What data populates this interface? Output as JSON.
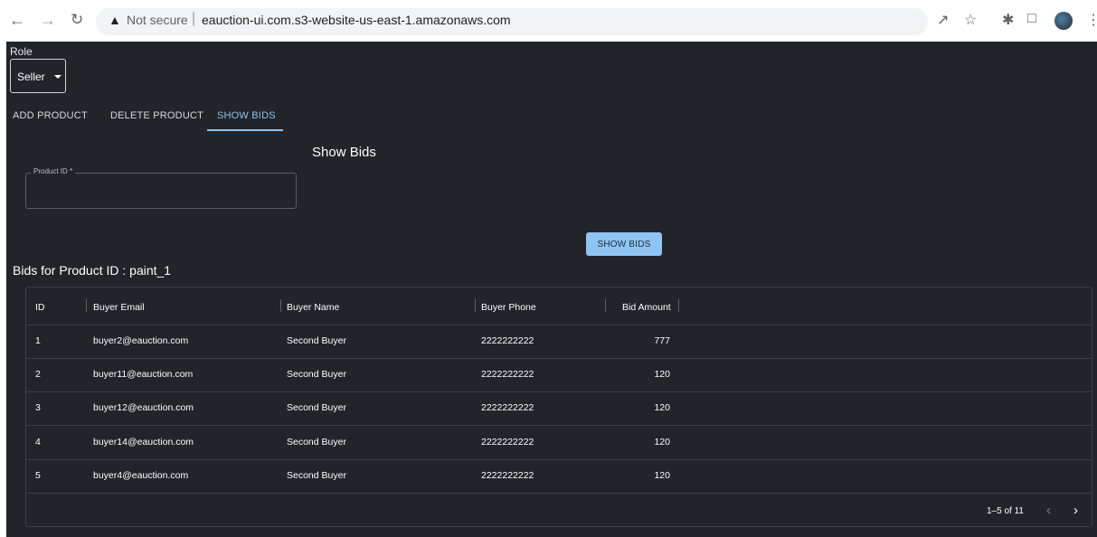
{
  "browser": {
    "back_icon": "arrow-left-icon",
    "forward_icon": "arrow-right-icon",
    "reload_icon": "reload-icon",
    "security_label": "Not secure",
    "url": "eauction-ui.com.s3-website-us-east-1.amazonaws.com",
    "icons": [
      "share-icon",
      "star-icon",
      "extensions-icon",
      "sidepanel-icon",
      "profile-avatar",
      "menu-icon"
    ]
  },
  "role": {
    "label": "Role",
    "value": "Seller"
  },
  "tabs": [
    {
      "label": "ADD PRODUCT",
      "active": false
    },
    {
      "label": "DELETE PRODUCT",
      "active": false
    },
    {
      "label": "SHOW BIDS",
      "active": true
    }
  ],
  "form": {
    "title": "Show Bids",
    "product_id_label": "Product ID *",
    "product_id_value": "",
    "submit_label": "SHOW BIDS"
  },
  "bids": {
    "heading": "Bids for Product ID : paint_1",
    "columns": [
      "ID",
      "Buyer Email",
      "Buyer Name",
      "Buyer Phone",
      "Bid Amount"
    ],
    "rows": [
      {
        "id": "1",
        "email": "buyer2@eauction.com",
        "name": "Second Buyer",
        "phone": "2222222222",
        "amount": "777"
      },
      {
        "id": "2",
        "email": "buyer11@eauction.com",
        "name": "Second Buyer",
        "phone": "2222222222",
        "amount": "120"
      },
      {
        "id": "3",
        "email": "buyer12@eauction.com",
        "name": "Second Buyer",
        "phone": "2222222222",
        "amount": "120"
      },
      {
        "id": "4",
        "email": "buyer14@eauction.com",
        "name": "Second Buyer",
        "phone": "2222222222",
        "amount": "120"
      },
      {
        "id": "5",
        "email": "buyer4@eauction.com",
        "name": "Second Buyer",
        "phone": "2222222222",
        "amount": "120"
      }
    ],
    "pagination": "1–5 of 11"
  },
  "colors": {
    "background": "#212429",
    "accent": "#8dc3f4"
  }
}
